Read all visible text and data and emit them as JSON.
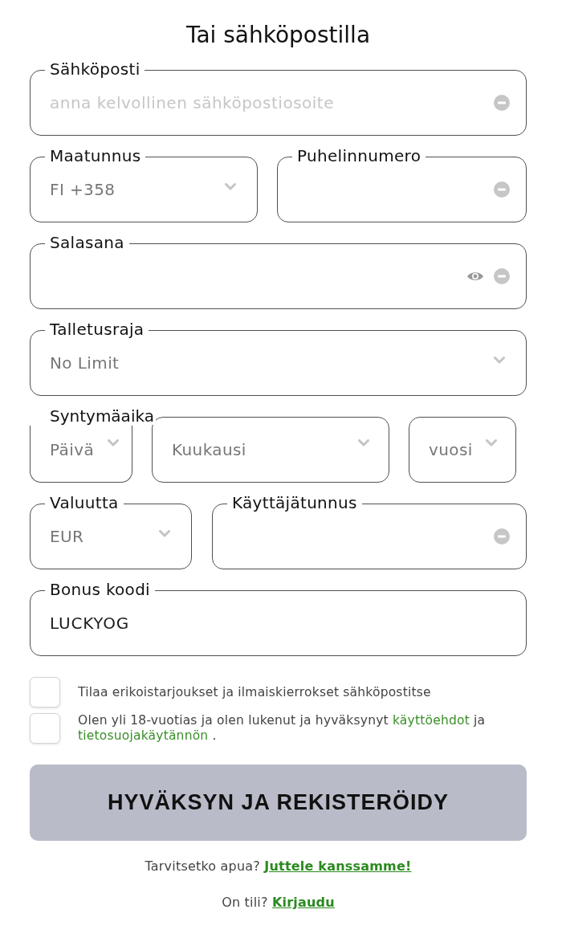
{
  "title": "Tai sähköpostilla",
  "rows": [
    [
      {
        "kind": "text",
        "label": "Sähköposti",
        "placeholder": "anna kelvollinen sähköpostiosoite"
      }
    ],
    [
      {
        "kind": "select",
        "label": "Maatunnus",
        "value": "FI +358"
      },
      {
        "kind": "text",
        "label": "Puhelinnumero"
      }
    ],
    [
      {
        "kind": "password",
        "label": "Salasana"
      }
    ],
    [
      {
        "kind": "select",
        "label": "Talletusraja",
        "value": "No Limit"
      }
    ],
    [
      {
        "kind": "date",
        "label": "Syntymäaika",
        "parts": [
          {
            "placeholder": "Päivä"
          },
          {
            "placeholder": "Kuukausi"
          },
          {
            "placeholder": "vuosi"
          }
        ]
      }
    ],
    [
      {
        "kind": "select",
        "label": "Valuutta",
        "value": "EUR"
      },
      {
        "kind": "text",
        "label": "Käyttäjätunnus"
      }
    ],
    [
      {
        "kind": "plain",
        "label": "Bonus koodi",
        "value": "LUCKYOG"
      }
    ]
  ],
  "consents": [
    {
      "checked": false,
      "segments": [
        {
          "kind": "text",
          "text": "Tilaa erikoistarjoukset ja ilmaiskierrokset sähköpostitse"
        }
      ]
    },
    {
      "checked": false,
      "segments": [
        {
          "kind": "text",
          "text": "Olen yli 18-vuotias ja olen lukenut ja hyväksynyt"
        },
        {
          "kind": "link",
          "text": "käyttöehdot"
        },
        {
          "kind": "text",
          "text": "ja"
        },
        {
          "kind": "link",
          "text": "tietosuojakäytännön"
        },
        {
          "kind": "text",
          "text": "."
        }
      ]
    }
  ],
  "submit": {
    "label": "HYVÄKSYN JA REKISTERÖIDY"
  },
  "footer_lines": [
    {
      "text": "Tarvitsetko apua?",
      "link": "Juttele kanssamme!"
    },
    {
      "text": "On tili?",
      "link": "Kirjaudu"
    }
  ]
}
